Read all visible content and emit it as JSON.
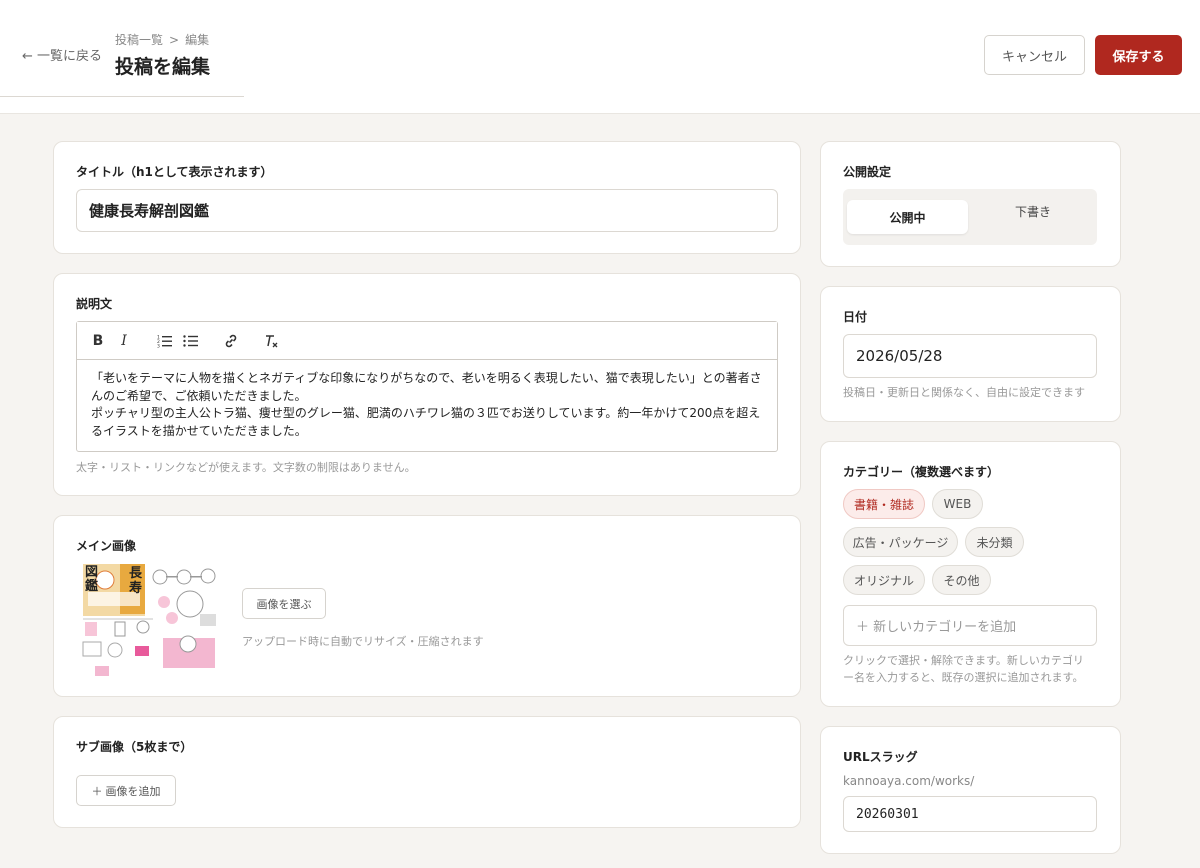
{
  "header": {
    "back_label": "← 一覧に戻る",
    "breadcrumb": [
      "投稿一覧",
      "編集"
    ],
    "breadcrumb_separator": ">",
    "title": "投稿を編集",
    "cancel_label": "キャンセル",
    "save_label": "保存する"
  },
  "colors": {
    "accent": "#b0281f",
    "background": "#f6f4f1",
    "card": "#ffffff"
  },
  "title_card": {
    "label": "タイトル（h1として表示されます）",
    "value": "健康長寿解剖図鑑"
  },
  "description_card": {
    "label": "説明文",
    "toolbar_icons": [
      "bold-icon",
      "italic-icon",
      "ordered-list-icon",
      "bullet-list-icon",
      "link-icon",
      "clear-format-icon"
    ],
    "content_lines": [
      "「老いをテーマに人物を描くとネガティブな印象になりがちなので、老いを明るく表現したい、猫で表現したい」との著者さんのご希望で、ご依頼いただきました。",
      "ポッチャリ型の主人公トラ猫、痩せ型のグレー猫、肥満のハチワレ猫の３匹でお送りしています。約一年かけて200点を超えるイラストを描かせていただきました。"
    ],
    "hint": "太字・リスト・リンクなどが使えます。文字数の制限はありません。"
  },
  "main_image_card": {
    "label": "メイン画像",
    "thumbnail_text": [
      "図鑑",
      "長寿"
    ],
    "choose_button": "画像を選ぶ",
    "hint": "アップロード時に自動でリサイズ・圧縮されます"
  },
  "sub_image_card": {
    "label": "サブ画像（5枚まで）",
    "add_button": "＋ 画像を追加"
  },
  "publish_card": {
    "label": "公開設定",
    "options": [
      "公開中",
      "下書き"
    ],
    "selected": "公開中"
  },
  "date_card": {
    "label": "日付",
    "value": "2026/05/28",
    "hint": "投稿日・更新日と関係なく、自由に設定できます"
  },
  "category_card": {
    "label": "カテゴリー（複数選べます）",
    "chips": [
      {
        "label": "書籍・雑誌",
        "selected": true
      },
      {
        "label": "WEB",
        "selected": false
      },
      {
        "label": "広告・パッケージ",
        "selected": false
      },
      {
        "label": "未分類",
        "selected": false
      },
      {
        "label": "オリジナル",
        "selected": false
      },
      {
        "label": "その他",
        "selected": false
      }
    ],
    "new_placeholder": "＋ 新しいカテゴリーを追加",
    "hint_lines": [
      "クリックで選択・解除できます。新しいカテゴリ",
      "ー名を入力すると、既存の選択に追加されます。"
    ]
  },
  "slug_card": {
    "label": "URLスラッグ",
    "prefix": "kannoaya.com/works/",
    "value": "20260301"
  }
}
